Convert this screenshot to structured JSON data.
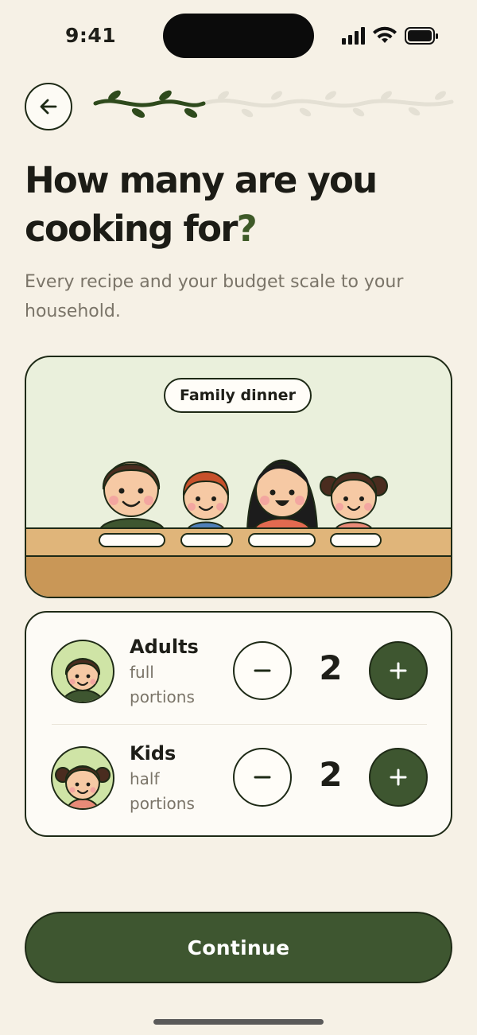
{
  "status_bar": {
    "time": "9:41"
  },
  "header": {
    "back_icon": "arrow-left-icon",
    "progress": {
      "completed_steps": 2,
      "total_steps": 8
    }
  },
  "title": {
    "main": "How many are you cooking for",
    "punct": "?"
  },
  "subtitle": "Every recipe and your budget scale to your household.",
  "illustration": {
    "label": "Family dinner"
  },
  "counters": [
    {
      "label": "Adults",
      "sub": "full portions",
      "value": "2",
      "avatar": "adult-avatar-icon"
    },
    {
      "label": "Kids",
      "sub": "half portions",
      "value": "2",
      "avatar": "kid-avatar-icon"
    }
  ],
  "continue_label": "Continue",
  "colors": {
    "background": "#f6f1e6",
    "accent": "#3e5630",
    "illustration_bg": "#eaf0dc",
    "table": "#e0b57a"
  }
}
